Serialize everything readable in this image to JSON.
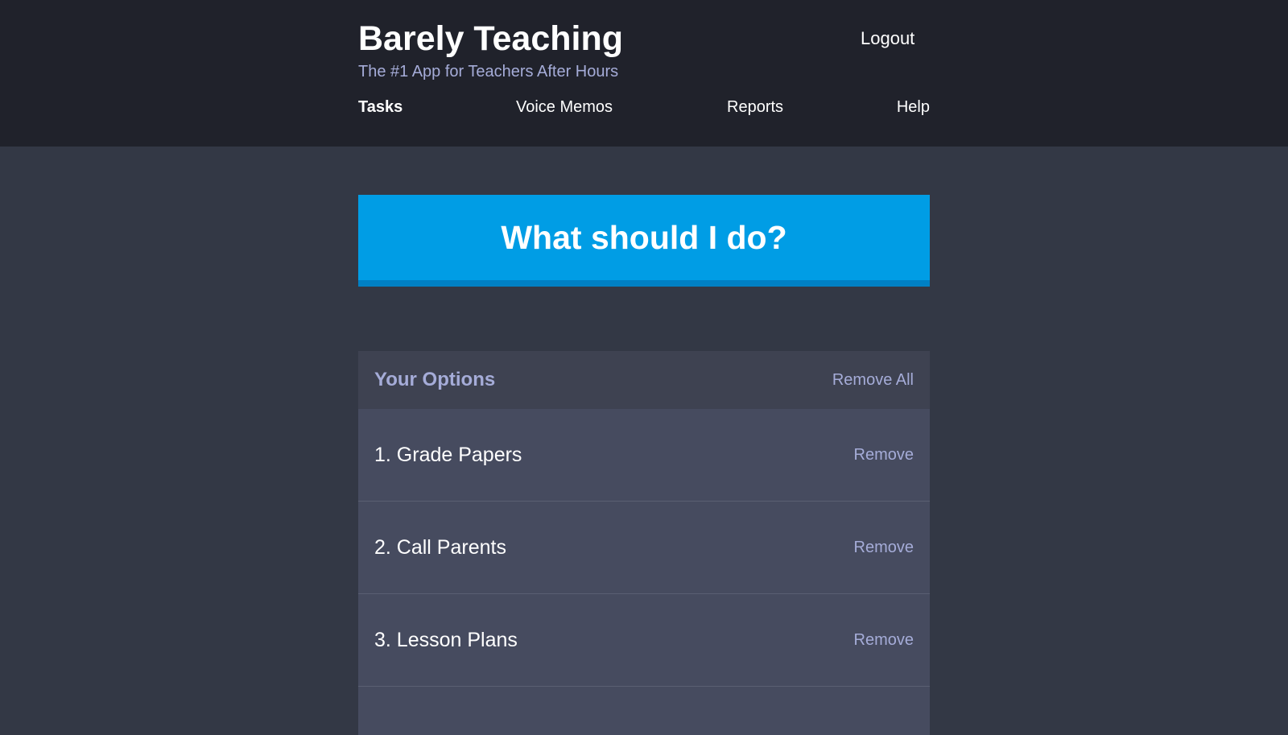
{
  "header": {
    "title": "Barely Teaching",
    "subtitle": "The #1 App for Teachers After Hours",
    "logout_label": "Logout",
    "nav": [
      "Tasks",
      "Voice Memos",
      "Reports",
      "Help"
    ]
  },
  "action": {
    "label": "What should I do?"
  },
  "options": {
    "title": "Your Options",
    "remove_all_label": "Remove All",
    "items": [
      {
        "text": "1. Grade Papers",
        "remove_label": "Remove"
      },
      {
        "text": "2. Call Parents",
        "remove_label": "Remove"
      },
      {
        "text": "3. Lesson Plans",
        "remove_label": "Remove"
      }
    ]
  },
  "colors": {
    "header_bg": "#20222b",
    "page_bg": "#333845",
    "accent": "#009de5",
    "accent_dark": "#0080c4",
    "muted_text": "#a5acd8",
    "row_bg": "#464b5f"
  }
}
